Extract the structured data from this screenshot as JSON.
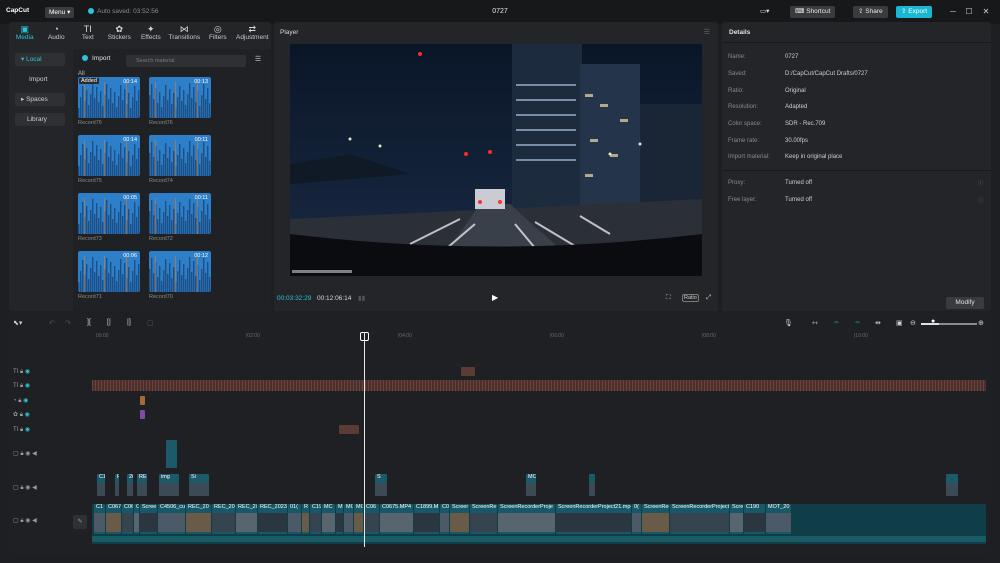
{
  "app": {
    "name": "CapCut",
    "menu_label": "Menu",
    "autosave": "Auto saved: 03:52:56",
    "project_title": "0727",
    "shortcut_label": "Shortcut",
    "share_label": "Share",
    "export_label": "Export"
  },
  "media_panel": {
    "tabs": [
      {
        "label": "Media",
        "icon": "media-icon"
      },
      {
        "label": "Audio",
        "icon": "audio-icon"
      },
      {
        "label": "Text",
        "icon": "text-icon"
      },
      {
        "label": "Stickers",
        "icon": "stickers-icon"
      },
      {
        "label": "Effects",
        "icon": "effects-icon"
      },
      {
        "label": "Transitions",
        "icon": "transitions-icon"
      },
      {
        "label": "Filters",
        "icon": "filters-icon"
      },
      {
        "label": "Adjustment",
        "icon": "adjustment-icon"
      }
    ],
    "sidebar": [
      "Local",
      "Import",
      "Spaces",
      "Library"
    ],
    "import_label": "Import",
    "search_placeholder": "Search material",
    "all_label": "All",
    "items": [
      {
        "name": "Record76",
        "duration": "00:14",
        "added": "Added"
      },
      {
        "name": "Record76",
        "duration": "00:13",
        "added": ""
      },
      {
        "name": "Record75",
        "duration": "00:14",
        "added": ""
      },
      {
        "name": "Record74",
        "duration": "00:11",
        "added": ""
      },
      {
        "name": "Record73",
        "duration": "00:05",
        "added": ""
      },
      {
        "name": "Record72",
        "duration": "00:11",
        "added": ""
      },
      {
        "name": "Record71",
        "duration": "00:06",
        "added": ""
      },
      {
        "name": "Record70",
        "duration": "00:12",
        "added": ""
      }
    ]
  },
  "player": {
    "title": "Player",
    "current_time": "00:03:32:29",
    "total_time": "00:12:06:14",
    "ratio_label": "Ratio"
  },
  "details": {
    "title": "Details",
    "rows": [
      {
        "key": "Name:",
        "value": "0727"
      },
      {
        "key": "Saved:",
        "value": "D:/CapCut/CapCut Drafts/0727"
      },
      {
        "key": "Ratio:",
        "value": "Original"
      },
      {
        "key": "Resolution:",
        "value": "Adapted"
      },
      {
        "key": "Color space:",
        "value": "SDR - Rec.709"
      },
      {
        "key": "Frame rate:",
        "value": "30.00fps"
      },
      {
        "key": "Import material:",
        "value": "Keep in original place"
      },
      {
        "key": "Proxy:",
        "value": "Turned off"
      },
      {
        "key": "Free layer:",
        "value": "Turned off"
      }
    ],
    "modify_label": "Modify"
  },
  "timeline": {
    "ruler": [
      "00:00",
      "|02:00",
      "|04:00",
      "|06:00",
      "|08:00",
      "|10:00"
    ],
    "clip_labels": {
      "main": [
        "C1",
        "C067",
        "C0671",
        "C",
        "Scree",
        "C4506_cut",
        "REC_20",
        "REC_202",
        "REC_202",
        "REC_20230(",
        "01(",
        "R",
        "C19",
        "MC",
        "M",
        "MC",
        "MO",
        "C06",
        "C0675.MP4",
        "C1899.M",
        "C0",
        "Screer",
        "ScreenRe",
        "ScreenRecorderProje",
        "ScreenRecorderProject21.mp4",
        "0(",
        "ScreenRec",
        "ScreenRecorderProject",
        "Scre",
        "C190",
        "MOT_20"
      ],
      "overlay": [
        "C1",
        "R",
        "2023",
        "REC_",
        "img",
        "Si",
        "S",
        "MO"
      ]
    }
  }
}
